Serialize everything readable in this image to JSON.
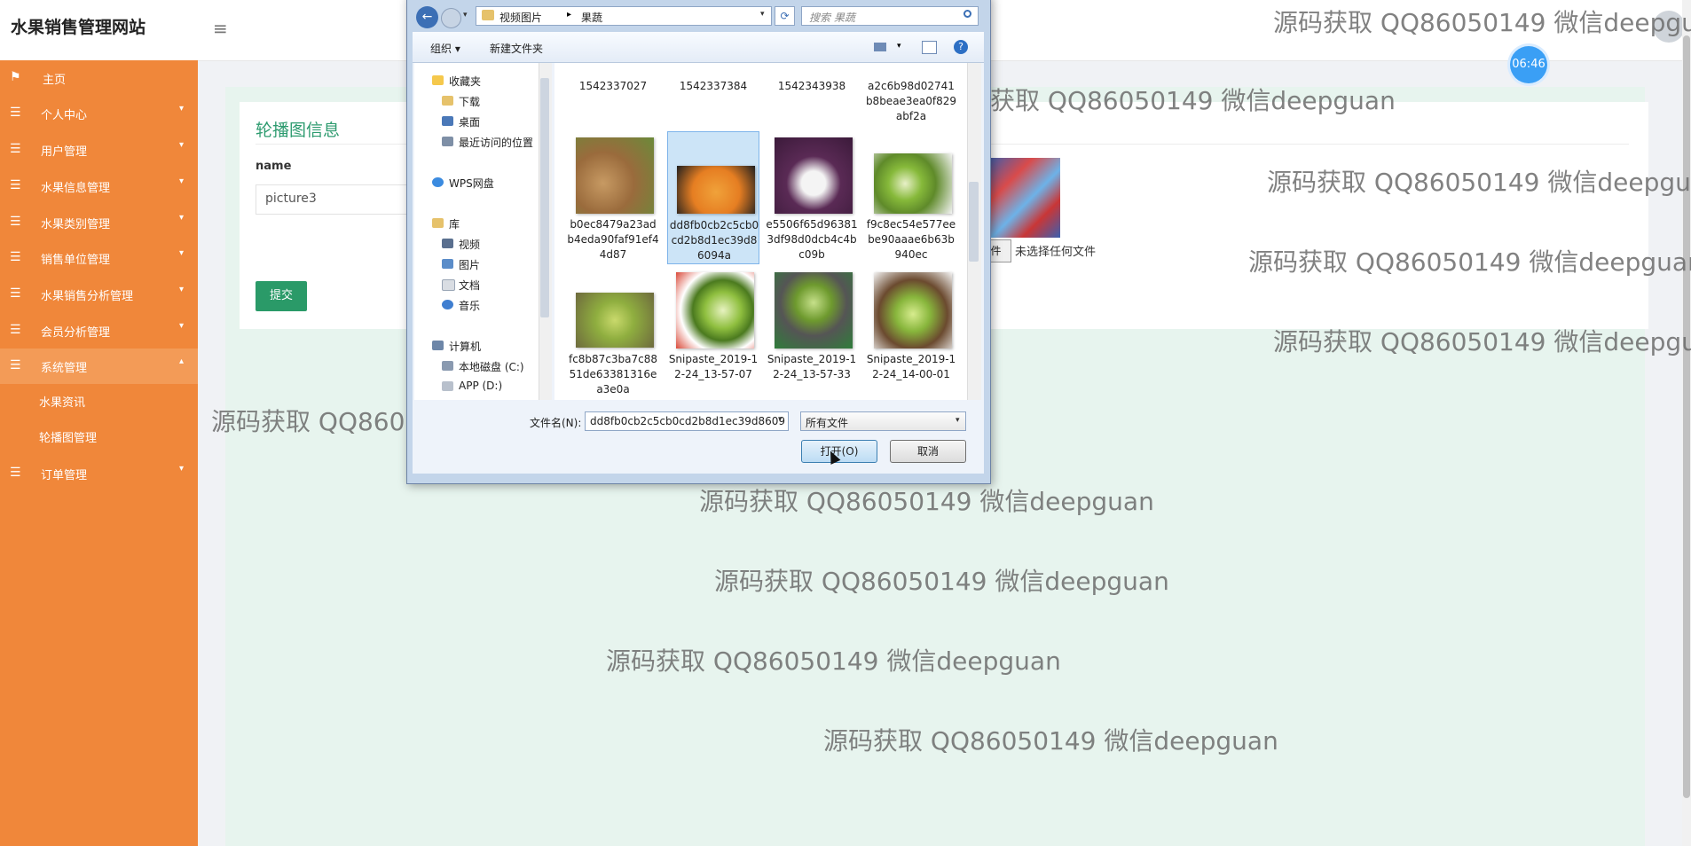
{
  "site": {
    "title": "水果销售管理网站",
    "timer": "06:46"
  },
  "sidebar": {
    "items": [
      {
        "label": "主页"
      },
      {
        "label": "个人中心"
      },
      {
        "label": "用户管理"
      },
      {
        "label": "水果信息管理"
      },
      {
        "label": "水果类别管理"
      },
      {
        "label": "销售单位管理"
      },
      {
        "label": "水果销售分析管理"
      },
      {
        "label": "会员分析管理"
      },
      {
        "label": "系统管理"
      },
      {
        "label": "水果资讯"
      },
      {
        "label": "轮播图管理"
      },
      {
        "label": "订单管理"
      }
    ]
  },
  "form": {
    "title": "轮播图信息",
    "name_label": "name",
    "name_value": "picture3",
    "submit": "提交",
    "file_button": "件",
    "file_none": "未选择任何文件"
  },
  "watermark": "源码获取 QQ86050149 微信deepguan",
  "dialog": {
    "path1": "视频图片",
    "path2": "果蔬",
    "search_placeholder": "搜索 果蔬",
    "toolbar_organize": "组织 ▾",
    "toolbar_newfolder": "新建文件夹",
    "tree": [
      {
        "label": "收藏夹"
      },
      {
        "label": "下载"
      },
      {
        "label": "桌面"
      },
      {
        "label": "最近访问的位置"
      },
      {
        "label": "WPS网盘"
      },
      {
        "label": "库"
      },
      {
        "label": "视频"
      },
      {
        "label": "图片"
      },
      {
        "label": "文档"
      },
      {
        "label": "音乐"
      },
      {
        "label": "计算机"
      },
      {
        "label": "本地磁盘 (C:)"
      },
      {
        "label": "APP (D:)"
      }
    ],
    "files": [
      {
        "name": "1542337027"
      },
      {
        "name": "1542337384"
      },
      {
        "name": "1542343938"
      },
      {
        "name": "a2c6b98d02741b8beae3ea0f829abf2a"
      },
      {
        "name": "b0ec8479a23adb4eda90faf91ef44d87"
      },
      {
        "name": "dd8fb0cb2c5cb0cd2b8d1ec39d86094a"
      },
      {
        "name": "e5506f65d963813df98d0dcb4c4bc09b"
      },
      {
        "name": "f9c8ec54e577eebe90aaae6b63b940ec"
      },
      {
        "name": "fc8b87c3ba7c8851de63381316ea3e0a"
      },
      {
        "name": "Snipaste_2019-12-24_13-57-07"
      },
      {
        "name": "Snipaste_2019-12-24_13-57-33"
      },
      {
        "name": "Snipaste_2019-12-24_14-00-01"
      }
    ],
    "filename_label": "文件名(N):",
    "filename_value": "dd8fb0cb2c5cb0cd2b8d1ec39d8609",
    "filetype": "所有文件",
    "open": "打开(O)",
    "cancel": "取消"
  }
}
